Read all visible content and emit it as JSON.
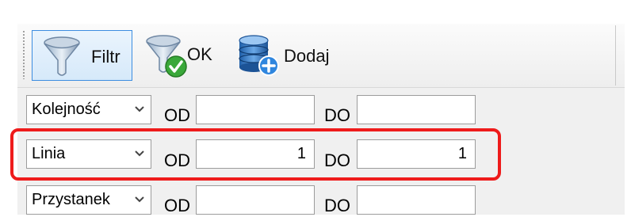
{
  "toolbar": {
    "filter_label": "Filtr",
    "ok_label": "OK",
    "add_label": "Dodaj"
  },
  "rows": [
    {
      "field": "Kolejność",
      "od_label": "OD",
      "od_value": "",
      "do_label": "DO",
      "do_value": ""
    },
    {
      "field": "Linia",
      "od_label": "OD",
      "od_value": "1",
      "do_label": "DO",
      "do_value": "1"
    },
    {
      "field": "Przystanek",
      "od_label": "OD",
      "od_value": "",
      "do_label": "DO",
      "do_value": ""
    }
  ],
  "colors": {
    "highlight": "#ee1b1b",
    "active_border": "#3c8de0"
  },
  "icons": [
    "funnel-icon",
    "funnel-check-icon",
    "database-add-icon",
    "chevron-down-icon"
  ]
}
